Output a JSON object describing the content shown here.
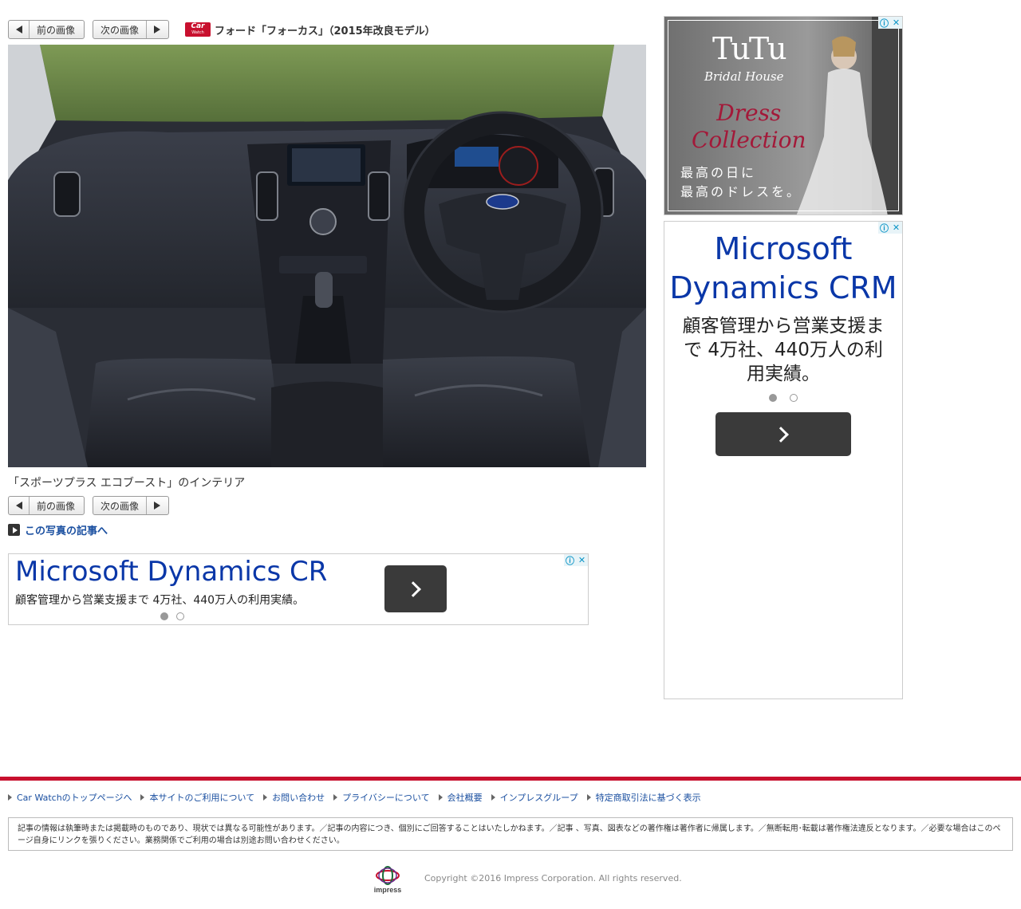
{
  "nav": {
    "prev_label": "前の画像",
    "next_label": "次の画像"
  },
  "header": {
    "logo_text": "Car",
    "logo_sub": "Watch",
    "title": "フォード「フォーカス」（2015年改良モデル）"
  },
  "photo": {
    "caption": "「スポーツプラス エコブースト」のインテリア"
  },
  "article_link": "この写真の記事へ",
  "ads": {
    "side_banner": {
      "brand": "TuTu",
      "subbrand": "Bridal House",
      "dress_line1": "Dress",
      "dress_line2": "Collection",
      "jp_line1": "最高の日に",
      "jp_line2": "最高のドレスを。"
    },
    "crm_headline": "Microsoft Dynamics CRM",
    "crm_sub": "顧客管理から営業支援まで 4万社、440万人の利用実績。",
    "info_icon": "ⓘ",
    "close_icon": "✕"
  },
  "footer": {
    "links": [
      "Car Watchのトップページへ",
      "本サイトのご利用について",
      "お問い合わせ",
      "プライバシーについて",
      "会社概要",
      "インプレスグループ",
      "特定商取引法に基づく表示"
    ],
    "notice": "記事の情報は執筆時または掲載時のものであり、現状では異なる可能性があります。／記事の内容につき、個別にご回答することはいたしかねます。／記事 、写真、図表などの著作権は著作者に帰属します。／無断転用･転載は著作権法違反となります。／必要な場合はこのページ自身にリンクを張りください。業務関係でご利用の場合は別途お問い合わせください。",
    "logo_text": "impress",
    "copyright": "Copyright ©2016 Impress Corporation. All rights reserved."
  },
  "colors": {
    "brand_red": "#c8102e",
    "link_blue": "#1a4fa0",
    "ad_blue": "#0a37a8"
  }
}
